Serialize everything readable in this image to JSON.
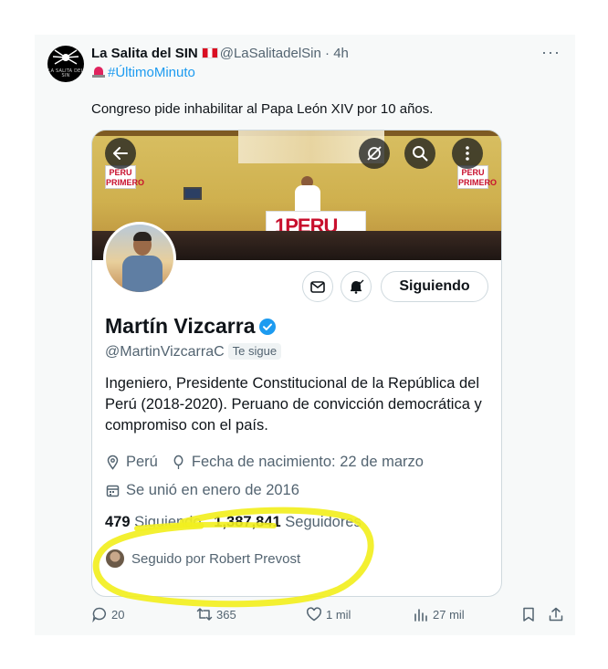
{
  "tweet": {
    "display_name": "La Salita del SIN",
    "avatar_text": "LA SALITA DEL SIN",
    "handle": "@LaSalitadelSin",
    "separator": "·",
    "time": "4h",
    "more_label": "···",
    "hashtag": "#ÚltimoMinuto",
    "text": "Congreso pide inhabilitar al Papa León XIV por 10 años."
  },
  "profile_card": {
    "banner_signs": [
      "PERU PRIMERO",
      "PERU PRIMERO"
    ],
    "banner_podium_text": "1PERU",
    "name": "Martín Vizcarra",
    "handle": "@MartinVizcarraC",
    "follows_you": "Te sigue",
    "follow_button": "Siguiendo",
    "bio": "Ingeniero, Presidente Constitucional de la República del Perú (2018-2020). Peruano de convicción democrática y compromiso con el país.",
    "location": "Perú",
    "birthday": "Fecha de nacimiento: 22 de marzo",
    "joined": "Se unió en enero de 2016",
    "following_count": "479",
    "following_label": "Siguiendo",
    "followers_count": "1,387,841",
    "followers_label": "Seguidores",
    "followed_by": "Seguido por Robert Prevost"
  },
  "actions": {
    "replies": "20",
    "retweets": "365",
    "likes": "1 mil",
    "views": "27 mil"
  },
  "colors": {
    "accent": "#1d9bf0",
    "highlight": "#f2ef1f",
    "secondary_text": "#536471"
  }
}
